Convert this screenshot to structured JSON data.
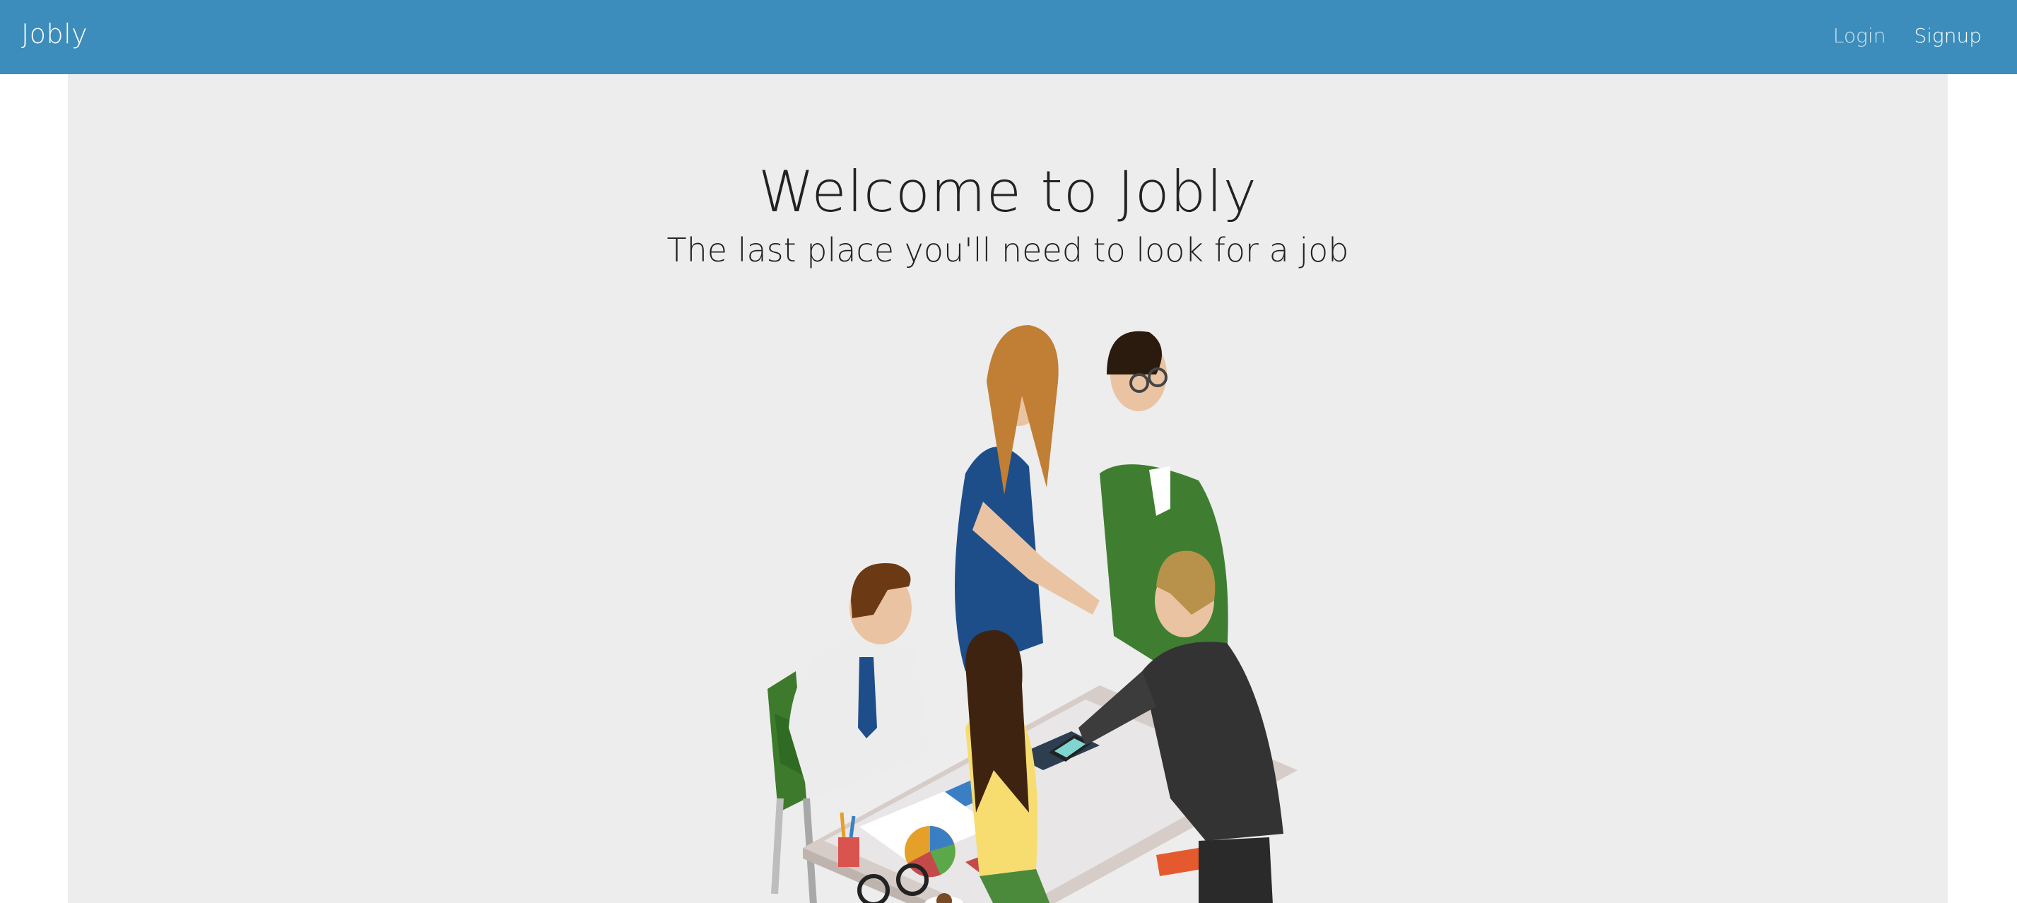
{
  "navbar": {
    "brand": "Jobly",
    "links": [
      {
        "label": "Login"
      },
      {
        "label": "Signup"
      }
    ],
    "background": "#3c8dbb"
  },
  "hero": {
    "title": "Welcome to Jobly",
    "subtitle": "The last place you'll need to look for a job",
    "background": "#ededed",
    "illustration": "team-meeting-illustration"
  }
}
